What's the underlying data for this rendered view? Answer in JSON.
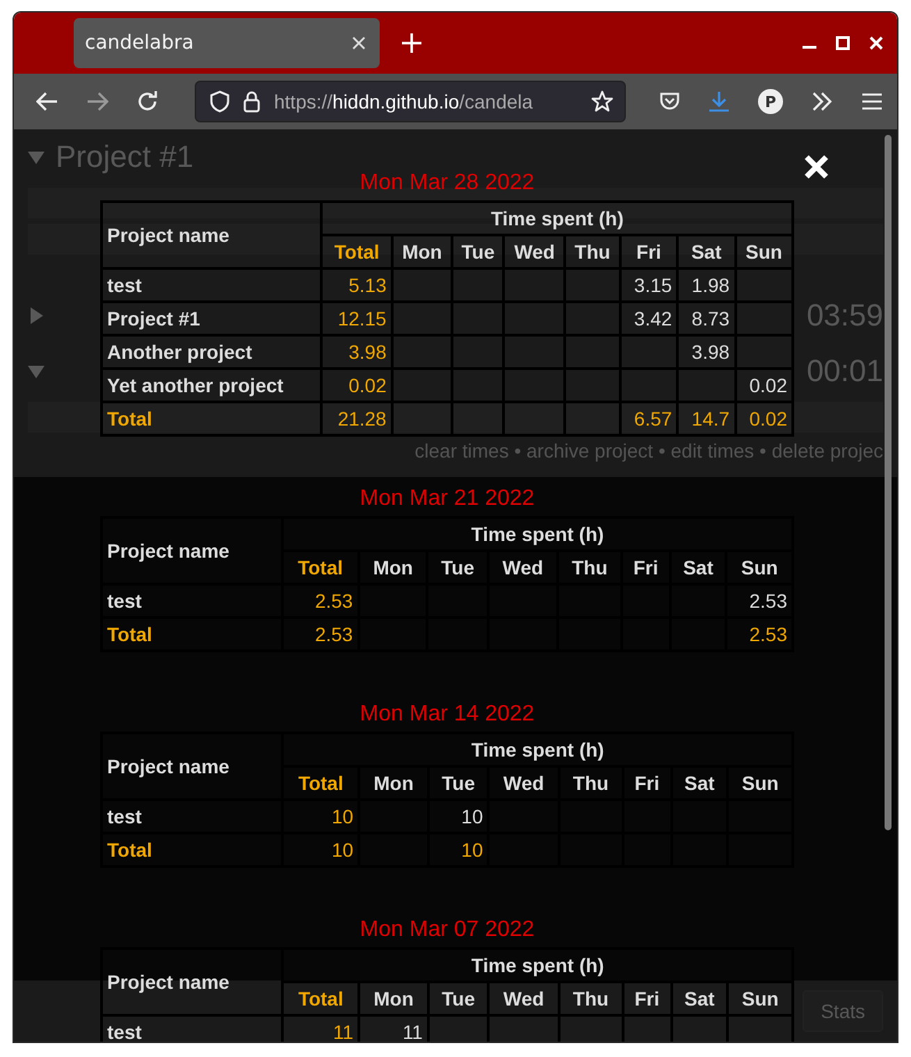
{
  "browser": {
    "tab_title": "candelabra",
    "url": {
      "scheme": "https://",
      "host": "hiddn.github.io",
      "path": "/candela"
    },
    "profile_initial": "P"
  },
  "background": {
    "sections": [
      {
        "expanded": true,
        "name": "Project #1"
      },
      {
        "expanded": false,
        "time": "03:59"
      },
      {
        "expanded": true,
        "time": "00:01",
        "actions": "clear times • archive project • edit times • delete projec"
      }
    ],
    "footer_button": "Stats"
  },
  "weeks": [
    {
      "date": "Mon Mar 28 2022",
      "header": {
        "name": "Project name",
        "group": "Time spent (h)",
        "total": "Total",
        "days": [
          "Mon",
          "Tue",
          "Wed",
          "Thu",
          "Fri",
          "Sat",
          "Sun"
        ]
      },
      "rows": [
        {
          "kind": "project",
          "name": "test",
          "total": "5.13",
          "days": {
            "fri": "3.15",
            "sat": "1.98"
          }
        },
        {
          "kind": "project",
          "name": "Project #1",
          "total": "12.15",
          "days": {
            "fri": "3.42",
            "sat": "8.73"
          }
        },
        {
          "kind": "project",
          "name": "Another project",
          "total": "3.98",
          "days": {
            "sat": "3.98"
          }
        },
        {
          "kind": "project",
          "name": "Yet another project",
          "total": "0.02",
          "days": {
            "sun": "0.02"
          }
        },
        {
          "kind": "total",
          "name": "Total",
          "total": "21.28",
          "days": {
            "fri": "6.57",
            "sat": "14.7",
            "sun": "0.02"
          }
        }
      ]
    },
    {
      "date": "Mon Mar 21 2022",
      "header": {
        "name": "Project name",
        "group": "Time spent (h)",
        "total": "Total",
        "days": [
          "Mon",
          "Tue",
          "Wed",
          "Thu",
          "Fri",
          "Sat",
          "Sun"
        ]
      },
      "rows": [
        {
          "kind": "project",
          "name": "test",
          "total": "2.53",
          "days": {
            "sun": "2.53"
          }
        },
        {
          "kind": "total",
          "name": "Total",
          "total": "2.53",
          "days": {
            "sun": "2.53"
          }
        }
      ]
    },
    {
      "date": "Mon Mar 14 2022",
      "header": {
        "name": "Project name",
        "group": "Time spent (h)",
        "total": "Total",
        "days": [
          "Mon",
          "Tue",
          "Wed",
          "Thu",
          "Fri",
          "Sat",
          "Sun"
        ]
      },
      "rows": [
        {
          "kind": "project",
          "name": "test",
          "total": "10",
          "days": {
            "tue": "10"
          }
        },
        {
          "kind": "total",
          "name": "Total",
          "total": "10",
          "days": {
            "tue": "10"
          }
        }
      ]
    },
    {
      "date": "Mon Mar 07 2022",
      "header": {
        "name": "Project name",
        "group": "Time spent (h)",
        "total": "Total",
        "days": [
          "Mon",
          "Tue",
          "Wed",
          "Thu",
          "Fri",
          "Sat",
          "Sun"
        ]
      },
      "rows": [
        {
          "kind": "project",
          "name": "test",
          "total": "11",
          "days": {
            "mon": "11"
          }
        }
      ]
    }
  ]
}
